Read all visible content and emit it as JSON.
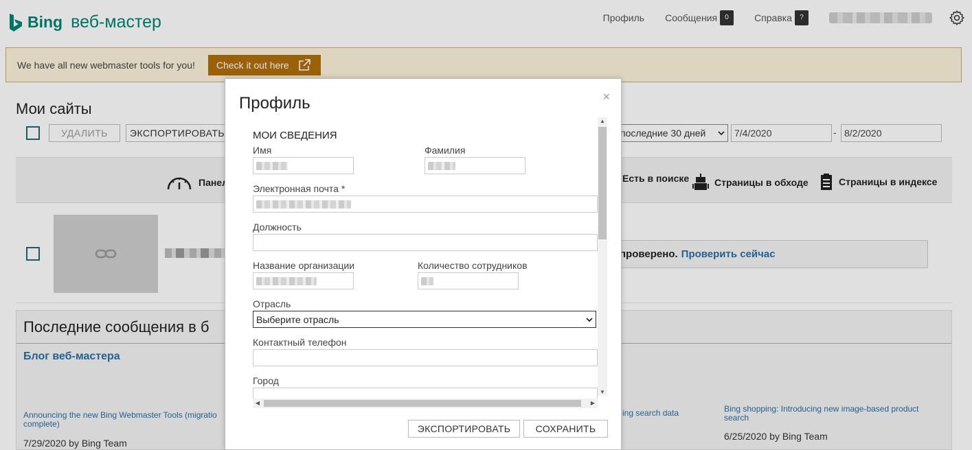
{
  "header": {
    "brand": "Bing",
    "product": "веб-мастер",
    "nav": [
      {
        "label": "Профиль"
      },
      {
        "label": "Сообщения",
        "badge": "0"
      },
      {
        "label": "Справка",
        "badge": "?"
      }
    ]
  },
  "banner": {
    "text": "We have all new webmaster tools for you!",
    "button": "Check it out here"
  },
  "sites": {
    "title": "Мои сайты",
    "delete": "УДАЛИТЬ",
    "export": "ЭКСПОРТИРОВАТЬ",
    "range": "последние 30 дней",
    "date_from": "7/4/2020",
    "date_sep": "-",
    "date_to": "8/2/2020",
    "stats": {
      "dashboard": "Панел",
      "search": "Есть в поиске",
      "crawled": "Страницы в обходе",
      "indexed": "Страницы в индексе"
    },
    "verify_text": "проверено.",
    "verify_link": "Проверить сейчас"
  },
  "messages": {
    "title": "Последние сообщения в б",
    "blog": "Блог веб-мастера",
    "post1_title": "Announcing the new Bing Webmaster Tools (migratio complete)",
    "post1_meta": "7/29/2020 by Bing Team",
    "post2_title": "ing search data",
    "post3_title": "Bing shopping: Introducing new image-based product search",
    "post3_meta": "6/25/2020 by Bing Team"
  },
  "modal": {
    "title": "Профиль",
    "close": "×",
    "section": "МОИ СВЕДЕНИЯ",
    "first_name": "Имя",
    "last_name": "Фамилия",
    "email": "Электронная почта *",
    "position": "Должность",
    "company": "Название организации",
    "employees": "Количество сотрудников",
    "industry": "Отрасль",
    "industry_value": "Выберите отрасль",
    "phone": "Контактный телефон",
    "city": "Город",
    "export": "ЭКСПОРТИРОВАТЬ",
    "save": "СОХРАНИТЬ"
  },
  "colors": {
    "brand": "#008373",
    "banner_button": "#b06f0b",
    "link": "#2a6ea6"
  }
}
